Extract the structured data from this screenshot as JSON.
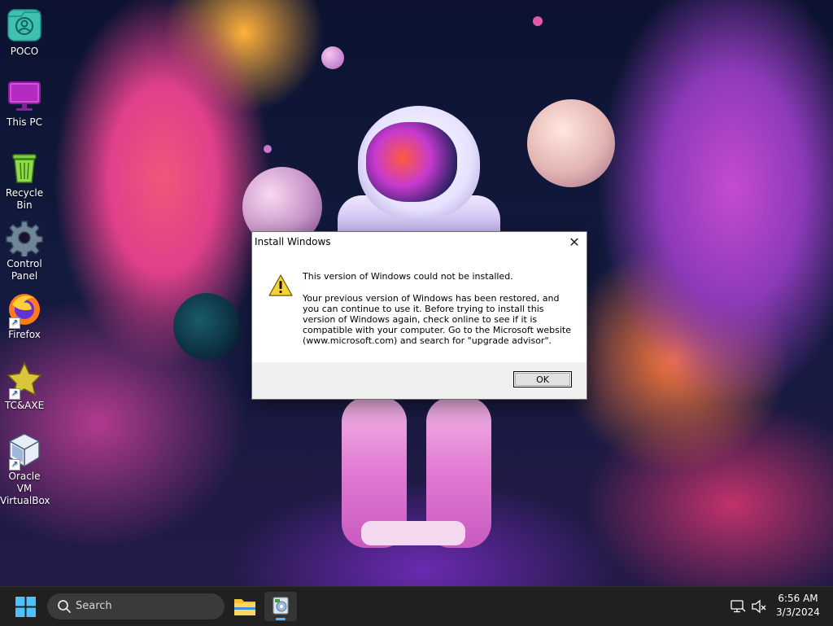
{
  "desktop": {
    "icons": [
      {
        "label": "POCO",
        "icon": "user-folder-icon"
      },
      {
        "label": "This PC",
        "icon": "monitor-icon"
      },
      {
        "label": "Recycle Bin",
        "icon": "recycle-bin-icon"
      },
      {
        "label": "Control Panel",
        "icon": "gear-icon"
      },
      {
        "label": "Firefox",
        "icon": "firefox-icon"
      },
      {
        "label": "TC&AXE",
        "icon": "star-icon"
      },
      {
        "label": "Oracle VM VirtualBox",
        "icon": "virtualbox-icon"
      }
    ]
  },
  "dialog": {
    "title": "Install Windows",
    "close_glyph": "✕",
    "heading": "This version of Windows could not be installed.",
    "message": "Your previous version of Windows has been restored, and you can continue to use it.  Before trying to install this version of Windows again, check online to see if it is compatible with your computer.  Go to the Microsoft website (www.microsoft.com) and search for \"upgrade advisor\".",
    "ok_label": "OK",
    "icon": "warning-icon"
  },
  "taskbar": {
    "search_placeholder": "Search",
    "apps": [
      "file-explorer-icon",
      "windows-setup-icon"
    ],
    "time": "6:56 AM",
    "date": "3/3/2024"
  },
  "colors": {
    "taskbar_bg": "#202020",
    "dialog_footer": "#f0f0f0",
    "accent": "#5ab3ff"
  }
}
